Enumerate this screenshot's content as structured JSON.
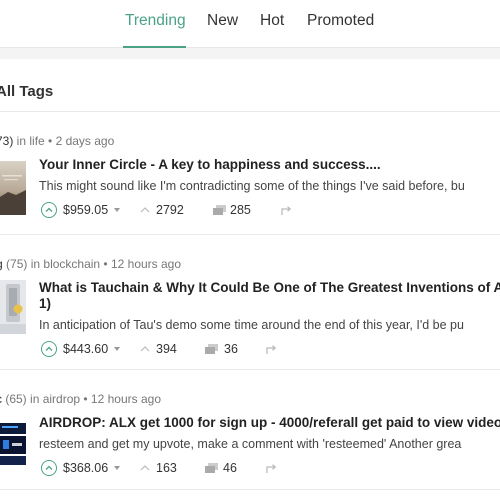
{
  "nav": {
    "tabs": [
      {
        "label": "Trending",
        "active": true
      },
      {
        "label": "New",
        "active": false
      },
      {
        "label": "Hot",
        "active": false
      },
      {
        "label": "Promoted",
        "active": false
      }
    ]
  },
  "feed": {
    "title": "All Tags",
    "posts": [
      {
        "author": "73)",
        "in_label": " in ",
        "category": "life",
        "time": " • 2 days ago",
        "title": "Your Inner Circle - A key to happiness and success....",
        "excerpt": "This might sound like I'm contradicting some of the things I've said before, bu",
        "payout": "$959.05",
        "votes": "2792",
        "comments": "285"
      },
      {
        "author": "g",
        "reputation": " (75)",
        "in_label": " in ",
        "category": "blockchain",
        "time": " • 12 hours ago",
        "title_line1": "What is Tauchain & Why It Could Be One of The Greatest Inventions of A",
        "title_line2": "1)",
        "excerpt": "In anticipation of Tau's demo some time around the end of this year, I'd be pu",
        "payout": "$443.60",
        "votes": "394",
        "comments": "36"
      },
      {
        "author": "c",
        "reputation": " (65)",
        "in_label": " in ",
        "category": "airdrop",
        "time": " • 12 hours ago",
        "title": "AIRDROP: ALX get 1000 for sign up - 4000/referall get paid to view video",
        "excerpt": "resteem and get my upvote, make a comment with 'resteemed' Another grea",
        "payout": "$368.06",
        "votes": "163",
        "comments": "46"
      }
    ]
  },
  "colors": {
    "accent": "#4ba287",
    "background": "#f4f4f4",
    "card": "#ffffff"
  },
  "icons": [
    "upvote-icon",
    "caret-down-icon",
    "votes-icon",
    "comment-icon",
    "reblog-icon"
  ]
}
